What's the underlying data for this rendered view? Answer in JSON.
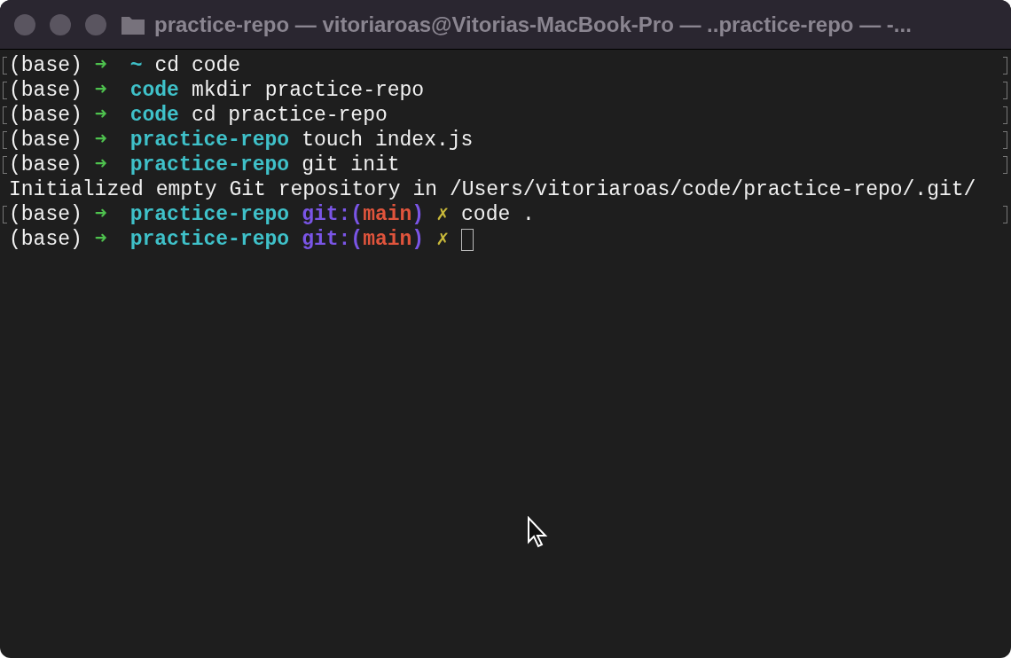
{
  "window": {
    "title": "practice-repo — vitoriaroas@Vitorias-MacBook-Pro — ..practice-repo — -..."
  },
  "lines": [
    {
      "kind": "prompt",
      "marked": true,
      "env": "(base)",
      "arrow": "➜",
      "cwd": "~",
      "command": "cd code"
    },
    {
      "kind": "prompt",
      "marked": true,
      "env": "(base)",
      "arrow": "➜",
      "cwd": "code",
      "command": "mkdir practice-repo"
    },
    {
      "kind": "prompt",
      "marked": true,
      "env": "(base)",
      "arrow": "➜",
      "cwd": "code",
      "command": "cd practice-repo"
    },
    {
      "kind": "prompt",
      "marked": true,
      "env": "(base)",
      "arrow": "➜",
      "cwd": "practice-repo",
      "command": "touch index.js"
    },
    {
      "kind": "prompt",
      "marked": true,
      "env": "(base)",
      "arrow": "➜",
      "cwd": "practice-repo",
      "command": "git init"
    },
    {
      "kind": "output",
      "text": "Initialized empty Git repository in /Users/vitoriaroas/code/practice-repo/.git/"
    },
    {
      "kind": "prompt",
      "marked": true,
      "env": "(base)",
      "arrow": "➜",
      "cwd": "practice-repo",
      "git_prefix": "git:(",
      "branch": "main",
      "git_suffix": ")",
      "dirty_mark": "✗",
      "command": "code ."
    },
    {
      "kind": "prompt",
      "marked": false,
      "env": "(base)",
      "arrow": "➜",
      "cwd": "practice-repo",
      "git_prefix": "git:(",
      "branch": "main",
      "git_suffix": ")",
      "dirty_mark": "✗",
      "cursor": true
    }
  ]
}
